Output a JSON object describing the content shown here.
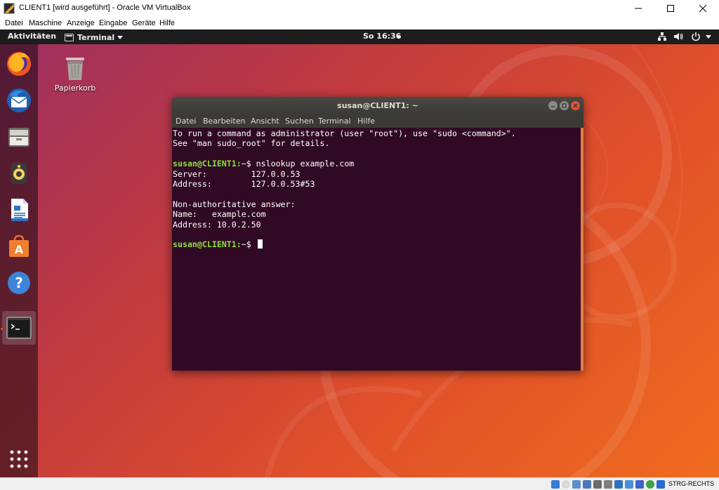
{
  "host_window": {
    "title": "CLIENT1 [wird ausgeführt] - Oracle VM VirtualBox",
    "menu": [
      "Datei",
      "Maschine",
      "Anzeige",
      "Eingabe",
      "Geräte",
      "Hilfe"
    ],
    "status_host_key": "STRG-RECHTS"
  },
  "topbar": {
    "activities": "Aktivitäten",
    "app_menu": "Terminal",
    "clock": "So 16:36"
  },
  "desktop": {
    "trash_label": "Papierkorb"
  },
  "dock": {
    "items": [
      "firefox-icon",
      "thunderbird-icon",
      "files-icon",
      "rhythmbox-icon",
      "writer-icon",
      "software-icon",
      "help-icon",
      "terminal-icon"
    ],
    "active": "terminal-icon"
  },
  "terminal": {
    "title": "susan@CLIENT1: ~",
    "menu": [
      "Datei",
      "Bearbeiten",
      "Ansicht",
      "Suchen",
      "Terminal",
      "Hilfe"
    ],
    "lines": [
      {
        "prompt": "",
        "text": "To run a command as administrator (user \"root\"), use \"sudo <command>\"."
      },
      {
        "prompt": "",
        "text": "See \"man sudo_root\" for details."
      },
      {
        "prompt": "",
        "text": ""
      },
      {
        "prompt": "susan@CLIENT1:",
        "text": "~$ nslookup example.com"
      },
      {
        "prompt": "",
        "text": "Server:         127.0.0.53"
      },
      {
        "prompt": "",
        "text": "Address:        127.0.0.53#53"
      },
      {
        "prompt": "",
        "text": ""
      },
      {
        "prompt": "",
        "text": "Non-authoritative answer:"
      },
      {
        "prompt": "",
        "text": "Name:   example.com"
      },
      {
        "prompt": "",
        "text": "Address: 10.0.2.50"
      },
      {
        "prompt": "",
        "text": ""
      },
      {
        "prompt": "susan@CLIENT1:",
        "text": "~$ "
      }
    ]
  },
  "colors": {
    "ubuntu_orange": "#e95420",
    "terminal_bg": "#300a24",
    "prompt_green": "#8ae234"
  }
}
